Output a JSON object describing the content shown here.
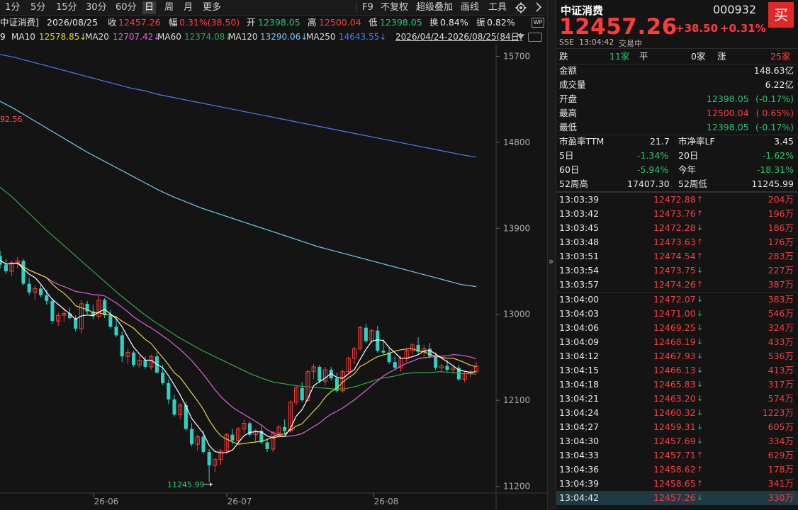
{
  "toolbar": {
    "periods": [
      "1分",
      "5分",
      "15分",
      "30分",
      "60分",
      "日",
      "周",
      "月",
      "更多"
    ],
    "active": "日",
    "right": [
      "F9",
      "不复权",
      "超级叠加",
      "画线",
      "工具"
    ],
    "settings_icon": "gear-icon"
  },
  "infobar": {
    "name": "中证消费]",
    "date": "2026/08/25",
    "close_label": "收",
    "close": "12457.26",
    "amp_label": "幅",
    "amp": "0.31%(38.50)",
    "open_label": "开",
    "open": "12398.05",
    "high_label": "高",
    "high": "12500.04",
    "low_label": "低",
    "low": "12398.05",
    "turn_label": "换",
    "turn": "0.84%",
    "swing_label": "振",
    "swing": "0.82%",
    "wp_badge": "WP"
  },
  "ma": {
    "ma5_tail": "9",
    "ma10_label": "MA10",
    "ma10": "12578.85↓",
    "ma20_label": "MA20",
    "ma20": "12707.42↓",
    "ma60_label": "MA60",
    "ma60": "12374.08↓",
    "ma120_label": "MA120",
    "ma120": "13290.06↓",
    "ma250_label": "MA250",
    "ma250": "14643.55↓",
    "range": "2026/04/24-2026/08/25(84日)"
  },
  "colors": {
    "ma5": "#ffffff",
    "ma10": "#e6d63a",
    "ma20": "#e060e0",
    "ma60": "#2fa84a",
    "ma120": "#6fc8f0",
    "ma250": "#4a7ef0",
    "up": "#ff3b3b",
    "down": "#2ed1c6"
  },
  "chart_data": {
    "type": "candlestick",
    "y_ticks": [
      "15700",
      "14800",
      "13900",
      "13000",
      "12100",
      "11200"
    ],
    "y_range": [
      11130,
      15830
    ],
    "x_labels": [
      "26-06",
      "26-07",
      "26-08"
    ],
    "high_marker": "92.56",
    "low_marker": "11245.99",
    "candles": [
      [
        13650,
        13720,
        13550,
        13610
      ],
      [
        13610,
        13660,
        13480,
        13520
      ],
      [
        13520,
        13580,
        13420,
        13450
      ],
      [
        13450,
        13560,
        13400,
        13540
      ],
      [
        13540,
        13600,
        13480,
        13560
      ],
      [
        13560,
        13580,
        13300,
        13320
      ],
      [
        13320,
        13380,
        13200,
        13230
      ],
      [
        13230,
        13300,
        13150,
        13270
      ],
      [
        13270,
        13310,
        13180,
        13200
      ],
      [
        13200,
        13260,
        13100,
        13140
      ],
      [
        13140,
        13170,
        12900,
        12930
      ],
      [
        12930,
        13020,
        12880,
        12990
      ],
      [
        12990,
        13050,
        12920,
        13010
      ],
      [
        13010,
        13070,
        12950,
        12960
      ],
      [
        12960,
        12990,
        12820,
        12850
      ],
      [
        12850,
        13150,
        12800,
        13110
      ],
      [
        13110,
        13140,
        13000,
        13030
      ],
      [
        13030,
        13100,
        12950,
        12980
      ],
      [
        12980,
        13200,
        12950,
        13150
      ],
      [
        13150,
        13170,
        12960,
        12990
      ],
      [
        12990,
        13050,
        12850,
        12870
      ],
      [
        12870,
        12980,
        12760,
        12780
      ],
      [
        12780,
        12820,
        12500,
        12560
      ],
      [
        12560,
        12640,
        12480,
        12600
      ],
      [
        12600,
        12620,
        12450,
        12470
      ],
      [
        12470,
        12570,
        12440,
        12520
      ],
      [
        12520,
        12560,
        12430,
        12450
      ],
      [
        12450,
        12580,
        12420,
        12560
      ],
      [
        12560,
        12600,
        12380,
        12390
      ],
      [
        12390,
        12470,
        12260,
        12280
      ],
      [
        12280,
        12320,
        12060,
        12110
      ],
      [
        12110,
        12160,
        11930,
        11950
      ],
      [
        11950,
        12070,
        11900,
        12050
      ],
      [
        12050,
        12090,
        11780,
        11800
      ],
      [
        11800,
        11860,
        11620,
        11640
      ],
      [
        11640,
        11740,
        11570,
        11720
      ],
      [
        11720,
        11780,
        11540,
        11560
      ],
      [
        11560,
        11590,
        11246,
        11420
      ],
      [
        11420,
        11500,
        11350,
        11480
      ],
      [
        11480,
        11590,
        11420,
        11570
      ],
      [
        11570,
        11760,
        11540,
        11740
      ],
      [
        11740,
        11800,
        11640,
        11680
      ],
      [
        11680,
        11820,
        11660,
        11800
      ],
      [
        11800,
        11900,
        11750,
        11860
      ],
      [
        11860,
        11880,
        11720,
        11740
      ],
      [
        11740,
        11800,
        11660,
        11780
      ],
      [
        11780,
        11830,
        11640,
        11660
      ],
      [
        11660,
        11700,
        11560,
        11590
      ],
      [
        11590,
        11780,
        11560,
        11760
      ],
      [
        11760,
        11840,
        11700,
        11820
      ],
      [
        11820,
        11900,
        11740,
        11780
      ],
      [
        11780,
        12100,
        11760,
        12080
      ],
      [
        12080,
        12250,
        12050,
        12230
      ],
      [
        12230,
        12290,
        12080,
        12100
      ],
      [
        12100,
        12420,
        12090,
        12400
      ],
      [
        12400,
        12480,
        12320,
        12450
      ],
      [
        12450,
        12470,
        12280,
        12300
      ],
      [
        12300,
        12450,
        12260,
        12420
      ],
      [
        12420,
        12450,
        12310,
        12330
      ],
      [
        12330,
        12390,
        12180,
        12200
      ],
      [
        12200,
        12420,
        12180,
        12400
      ],
      [
        12400,
        12560,
        12370,
        12540
      ],
      [
        12540,
        12660,
        12480,
        12640
      ],
      [
        12640,
        12880,
        12620,
        12860
      ],
      [
        12860,
        12900,
        12700,
        12720
      ],
      [
        12720,
        12850,
        12700,
        12830
      ],
      [
        12830,
        12880,
        12600,
        12620
      ],
      [
        12620,
        12740,
        12580,
        12600
      ],
      [
        12600,
        12650,
        12480,
        12500
      ],
      [
        12500,
        12560,
        12420,
        12440
      ],
      [
        12440,
        12560,
        12400,
        12540
      ],
      [
        12540,
        12650,
        12500,
        12620
      ],
      [
        12620,
        12700,
        12580,
        12680
      ],
      [
        12680,
        12760,
        12590,
        12610
      ],
      [
        12610,
        12680,
        12560,
        12640
      ],
      [
        12640,
        12700,
        12540,
        12560
      ],
      [
        12560,
        12600,
        12420,
        12440
      ],
      [
        12440,
        12480,
        12390,
        12460
      ],
      [
        12460,
        12520,
        12400,
        12420
      ],
      [
        12420,
        12460,
        12380,
        12440
      ],
      [
        12440,
        12470,
        12300,
        12320
      ],
      [
        12320,
        12400,
        12290,
        12380
      ],
      [
        12380,
        12420,
        12340,
        12400
      ],
      [
        12398,
        12500,
        12398,
        12457
      ]
    ],
    "series": [
      {
        "name": "MA250",
        "color": "#4a7ef0",
        "values": [
          15720,
          15690,
          15650,
          15610,
          15570,
          15530,
          15490,
          15450,
          15410,
          15370,
          15340,
          15300,
          15270,
          15240,
          15210,
          15180,
          15150,
          15120,
          15090,
          15060,
          15030,
          15000,
          14970,
          14940,
          14910,
          14880,
          14850,
          14820,
          14790,
          14760,
          14730,
          14700,
          14670,
          14645
        ]
      },
      {
        "name": "MA120",
        "color": "#6fc8f0",
        "values": [
          15230,
          15150,
          15060,
          14970,
          14880,
          14790,
          14700,
          14620,
          14540,
          14460,
          14380,
          14300,
          14230,
          14170,
          14110,
          14060,
          14010,
          13960,
          13910,
          13860,
          13810,
          13760,
          13710,
          13670,
          13630,
          13590,
          13550,
          13510,
          13470,
          13430,
          13390,
          13350,
          13310,
          13290
        ]
      },
      {
        "name": "MA60",
        "color": "#2fa84a",
        "values": [
          14330,
          14230,
          14110,
          13990,
          13870,
          13760,
          13650,
          13540,
          13430,
          13320,
          13210,
          13110,
          13010,
          12920,
          12840,
          12760,
          12690,
          12620,
          12560,
          12500,
          12440,
          12380,
          12330,
          12290,
          12270,
          12250,
          12240,
          12230,
          12220,
          12220,
          12250,
          12290,
          12330,
          12350,
          12380,
          12390,
          12390,
          12400,
          12390,
          12380,
          12374
        ]
      }
    ]
  },
  "stock": {
    "name": "中证消费",
    "code": "000932",
    "buy": "买",
    "price": "12457.26",
    "change": "+38.50",
    "pct": "+0.31%",
    "exchange": "SSE",
    "time": "13:04:42",
    "status": "交易中",
    "down_label": "跌",
    "down_count": "11家",
    "flat_label": "平",
    "flat_count": "0家",
    "up_label": "涨",
    "up_count": "25家",
    "amount_label": "金额",
    "amount": "148.63亿",
    "volume_label": "成交量",
    "volume": "6.22亿",
    "open_label": "开盘",
    "open": "12398.05",
    "open_pct": "(-0.17%)",
    "high_label": "最高",
    "high": "12500.04",
    "high_pct": "( 0.65%)",
    "low_label": "最低",
    "low": "12398.05",
    "low_pct": "(-0.17%)",
    "pe_label": "市盈率TTM",
    "pe": "21.7",
    "pb_label": "市净率LF",
    "pb": "3.45",
    "d5_label": "5日",
    "d5": "-1.34%",
    "d20_label": "20日",
    "d20": "-1.62%",
    "d60_label": "60日",
    "d60": "-5.94%",
    "ytd_label": "今年",
    "ytd": "-18.31%",
    "h52_label": "52周高",
    "h52": "17407.30",
    "l52_label": "52周低",
    "l52": "11245.99"
  },
  "ticks": [
    {
      "t": "13:03:39",
      "p": "12472.88",
      "d": "up",
      "v": "204万"
    },
    {
      "t": "13:03:42",
      "p": "12473.76",
      "d": "up",
      "v": "196万"
    },
    {
      "t": "13:03:45",
      "p": "12472.28",
      "d": "down",
      "v": "186万"
    },
    {
      "t": "13:03:48",
      "p": "12473.63",
      "d": "up",
      "v": "176万"
    },
    {
      "t": "13:03:51",
      "p": "12474.54",
      "d": "up",
      "v": "283万"
    },
    {
      "t": "13:03:54",
      "p": "12473.75",
      "d": "down",
      "v": "227万"
    },
    {
      "t": "13:03:57",
      "p": "12474.26",
      "d": "up",
      "v": "387万"
    },
    {
      "t": "13:04:00",
      "p": "12472.07",
      "d": "down",
      "v": "383万"
    },
    {
      "t": "13:04:03",
      "p": "12471.00",
      "d": "down",
      "v": "546万"
    },
    {
      "t": "13:04:06",
      "p": "12469.25",
      "d": "down",
      "v": "324万"
    },
    {
      "t": "13:04:09",
      "p": "12468.19",
      "d": "down",
      "v": "433万"
    },
    {
      "t": "13:04:12",
      "p": "12467.93",
      "d": "down",
      "v": "536万"
    },
    {
      "t": "13:04:15",
      "p": "12466.13",
      "d": "down",
      "v": "413万"
    },
    {
      "t": "13:04:18",
      "p": "12465.83",
      "d": "down",
      "v": "317万"
    },
    {
      "t": "13:04:21",
      "p": "12463.20",
      "d": "down",
      "v": "574万"
    },
    {
      "t": "13:04:24",
      "p": "12460.32",
      "d": "down",
      "v": "1223万"
    },
    {
      "t": "13:04:27",
      "p": "12459.31",
      "d": "down",
      "v": "605万"
    },
    {
      "t": "13:04:30",
      "p": "12457.69",
      "d": "down",
      "v": "334万"
    },
    {
      "t": "13:04:33",
      "p": "12457.71",
      "d": "up",
      "v": "629万"
    },
    {
      "t": "13:04:36",
      "p": "12458.62",
      "d": "up",
      "v": "178万"
    },
    {
      "t": "13:04:39",
      "p": "12458.65",
      "d": "up",
      "v": "341万"
    },
    {
      "t": "13:04:42",
      "p": "12457.26",
      "d": "down",
      "v": "330万"
    }
  ],
  "collapse_arrow": "»"
}
